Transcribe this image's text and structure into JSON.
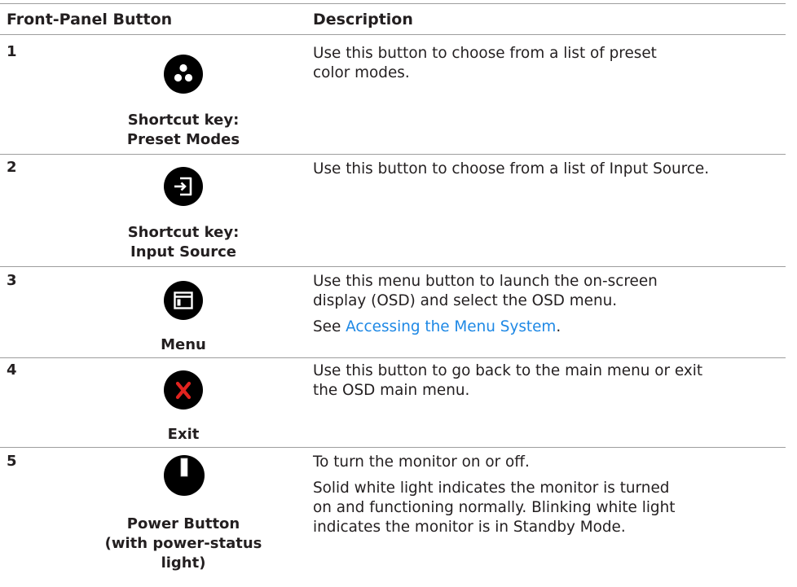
{
  "header": {
    "col1": "Front-Panel Button",
    "col2": "Description"
  },
  "rows": [
    {
      "number": "1",
      "icon": "preset-modes-icon",
      "caption_line1": "Shortcut key:",
      "caption_line2": "Preset Modes",
      "desc_line1": "Use this button to choose from a list of preset",
      "desc_line2": "color modes."
    },
    {
      "number": "2",
      "icon": "input-source-icon",
      "caption_line1": "Shortcut key:",
      "caption_line2": "Input Source",
      "desc_line1": "Use this button to choose from a list of Input Source."
    },
    {
      "number": "3",
      "icon": "menu-icon",
      "caption_line1": "Menu",
      "desc_line1": "Use this menu button to launch the on-screen",
      "desc_line2": "display (OSD) and select the OSD menu.",
      "see_prefix": "See ",
      "link_text": "Accessing the Menu System",
      "see_suffix": "."
    },
    {
      "number": "4",
      "icon": "exit-icon",
      "caption_line1": "Exit",
      "desc_line1": "Use this button to go back to the main menu or exit",
      "desc_line2": "the OSD main menu."
    },
    {
      "number": "5",
      "icon": "power-icon",
      "caption_line1": "Power Button",
      "caption_line2": "(with power-status light)",
      "desc_line1": "To turn the monitor on or off.",
      "para2_line1": "Solid white light indicates the monitor is turned",
      "para2_line2": "on and functioning normally. Blinking white light",
      "para2_line3": "indicates the monitor is in Standby Mode."
    }
  ],
  "colors": {
    "icon_fill": "#000000",
    "exit_x": "#e1231f",
    "link": "#1e88e5",
    "rule": "#9d9d9d"
  }
}
